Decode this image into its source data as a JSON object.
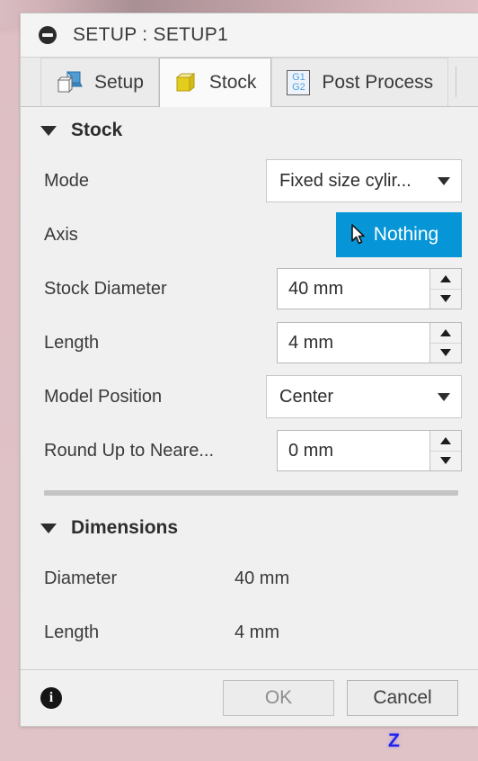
{
  "window": {
    "title": "SETUP : SETUP1",
    "title_icon": "minimize-circle-icon"
  },
  "tabs": [
    {
      "id": "setup",
      "label": "Setup",
      "icon": "cube-blue-icon",
      "active": false
    },
    {
      "id": "stock",
      "label": "Stock",
      "icon": "cube-yellow-icon",
      "active": true
    },
    {
      "id": "post-process",
      "label": "Post Process",
      "icon": "gcode-g1g2-icon",
      "active": false
    }
  ],
  "stock_section": {
    "title": "Stock",
    "expanded": true,
    "rows": {
      "mode": {
        "label": "Mode",
        "value": "Fixed size cylir...",
        "type": "dropdown"
      },
      "axis": {
        "label": "Axis",
        "value": "Nothing",
        "type": "selection",
        "icon": "cursor-arrow-icon",
        "color": "#0696d7"
      },
      "stock_diameter": {
        "label": "Stock Diameter",
        "value": "40 mm",
        "type": "spinner"
      },
      "length": {
        "label": "Length",
        "value": "4 mm",
        "type": "spinner"
      },
      "model_position": {
        "label": "Model Position",
        "value": "Center",
        "type": "dropdown"
      },
      "round_up": {
        "label": "Round Up to Neare...",
        "value": "0 mm",
        "type": "spinner"
      }
    }
  },
  "dimensions_section": {
    "title": "Dimensions",
    "expanded": true,
    "rows": [
      {
        "label": "Diameter",
        "value": "40 mm"
      },
      {
        "label": "Length",
        "value": "4 mm"
      }
    ]
  },
  "footer": {
    "info_icon": "info-icon",
    "ok_label": "OK",
    "cancel_label": "Cancel"
  },
  "viewport": {
    "axis_label": "Z",
    "axis_color": "#2222ee",
    "background_color": "#ddbfc4"
  }
}
